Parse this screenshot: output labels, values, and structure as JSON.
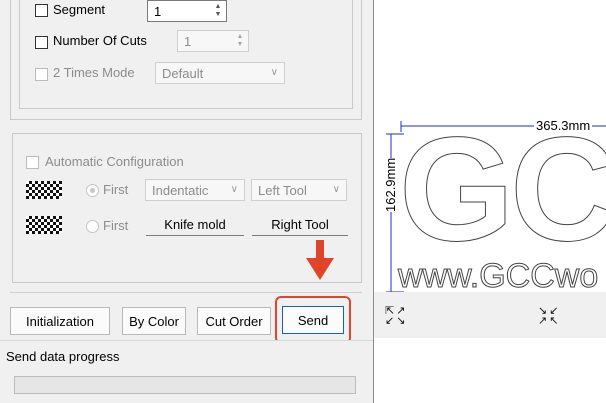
{
  "options": {
    "segment": {
      "label": "Segment",
      "value": "1"
    },
    "number_of_cuts": {
      "label": "Number Of Cuts",
      "value": "1"
    },
    "two_times_mode": {
      "label": "2 Times Mode",
      "value": "Default"
    }
  },
  "tools": {
    "auto_config_label": "Automatic Configuration",
    "row1": {
      "first_label": "First",
      "mode": "Indentatic",
      "tool": "Left Tool"
    },
    "row2": {
      "first_label": "First",
      "mode": "Knife mold",
      "tool": "Right Tool"
    }
  },
  "buttons": {
    "initialization": "Initialization",
    "by_color": "By Color",
    "cut_order": "Cut Order",
    "send": "Send"
  },
  "progress": {
    "label": "Send data progress",
    "value": 0
  },
  "preview": {
    "width_dim": "365.3mm",
    "height_dim": "162.9mm",
    "big_text": "GC",
    "url_text": "www.GCCwo"
  },
  "colors": {
    "highlight": "#e0452b",
    "accent_blue": "#1f2ccc",
    "send_border": "#0a64c8"
  },
  "icons": {
    "arrow": "down-arrow-icon",
    "fit": "expand-corners-icon",
    "shrink": "shrink-corners-icon"
  }
}
